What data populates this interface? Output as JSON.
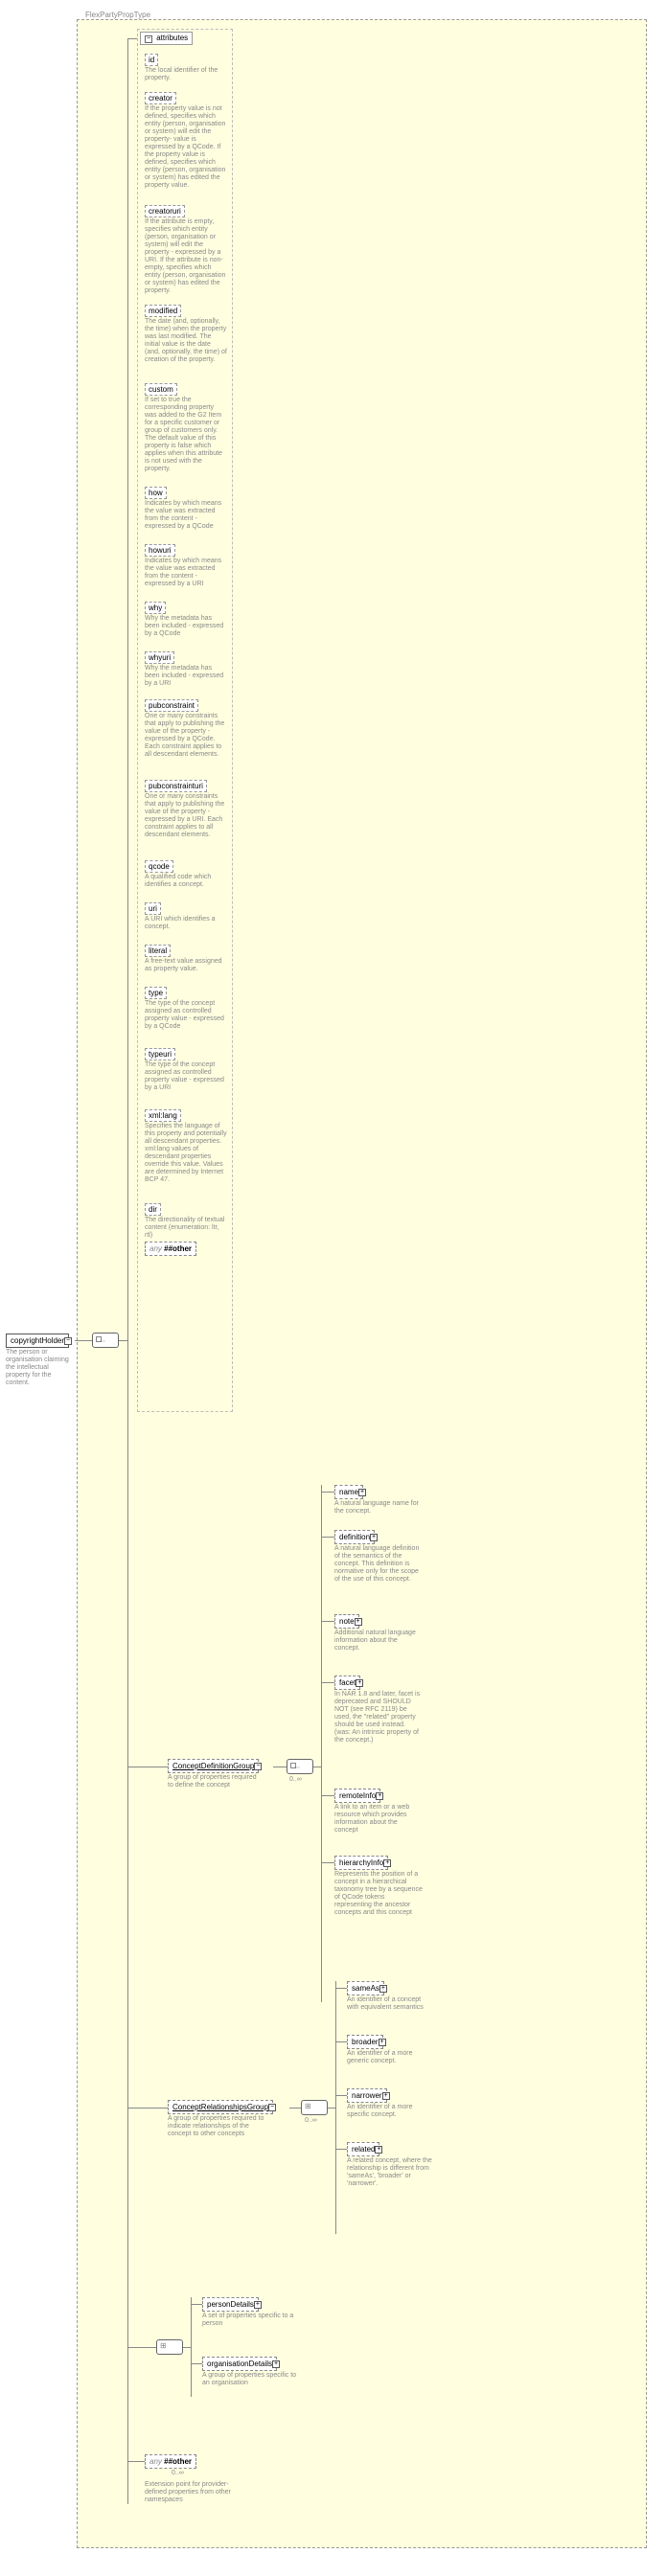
{
  "type": {
    "name": "FlexPartyPropType"
  },
  "root": {
    "name": "copyrightHolder",
    "doc": "The person or organisation claiming the intellectual property for the content."
  },
  "attributes": {
    "header": "attributes",
    "items": [
      {
        "name": "id",
        "doc": "The local identifier of the property."
      },
      {
        "name": "creator",
        "doc": "If the property value is not defined, specifies which entity (person, organisation or system) will edit the property- value is expressed by a QCode. If the property value is defined, specifies which entity (person, organisation or system) has edited the property value."
      },
      {
        "name": "creatoruri",
        "doc": "If the attribute is empty, specifies which entity (person, organisation or system) will edit the property - expressed by a URI. If the attribute is non-empty, specifies which entity (person, organisation or system) has edited the property."
      },
      {
        "name": "modified",
        "doc": "The date (and, optionally, the time) when the property was last modified. The initial value is the date (and, optionally, the time) of creation of the property."
      },
      {
        "name": "custom",
        "doc": "If set to true the corresponding property was added to the G2 Item for a specific customer or group of customers only. The default value of this property is false which applies when this attribute is not used with the property."
      },
      {
        "name": "how",
        "doc": "Indicates by which means the value was extracted from the content - expressed by a QCode"
      },
      {
        "name": "howuri",
        "doc": "Indicates by which means the value was extracted from the content - expressed by a URI"
      },
      {
        "name": "why",
        "doc": "Why the metadata has been included - expressed by a QCode"
      },
      {
        "name": "whyuri",
        "doc": "Why the metadata has been included - expressed by a URI"
      },
      {
        "name": "pubconstraint",
        "doc": "One or many constraints that apply to publishing the value of the property - expressed by a QCode. Each constraint applies to all descendant elements."
      },
      {
        "name": "pubconstrainturi",
        "doc": "One or many constraints that apply to publishing the value of the property - expressed by a URI. Each constraint applies to all descendant elements."
      },
      {
        "name": "qcode",
        "doc": "A qualified code which identifies a concept."
      },
      {
        "name": "uri",
        "doc": "A URI which identifies a concept."
      },
      {
        "name": "literal",
        "doc": "A free-text value assigned as property value."
      },
      {
        "name": "type",
        "doc": "The type of the concept assigned as controlled property value - expressed by a QCode"
      },
      {
        "name": "typeuri",
        "doc": "The type of the concept assigned as controlled property value - expressed by a URI"
      },
      {
        "name": "xml:lang",
        "doc": "Specifies the language of this property and potentially all descendant properties. xml:lang values of descendant properties override this value. Values are determined by Internet BCP 47."
      },
      {
        "name": "dir",
        "doc": "The directionality of textual content (enumeration: ltr, rtl)"
      }
    ],
    "any_label": "##other",
    "any_prefix": "any"
  },
  "groups": {
    "concept_def": {
      "name": "ConceptDefinitionGroup",
      "doc": "A group of properties required to define the concept",
      "occur": "0..∞",
      "children": [
        {
          "name": "name",
          "doc": "A natural language name for the concept."
        },
        {
          "name": "definition",
          "doc": "A natural language definition of the semantics of the concept. This definition is normative only for the scope of the use of this concept."
        },
        {
          "name": "note",
          "doc": "Additional natural language information about the concept."
        },
        {
          "name": "facet",
          "doc": "In NAR 1.8 and later, facet is deprecated and SHOULD NOT (see RFC 2119) be used, the \"related\" property should be used instead. (was: An intrinsic property of the concept.)"
        },
        {
          "name": "remoteInfo",
          "doc": "A link to an item or a web resource which provides information about the concept"
        },
        {
          "name": "hierarchyInfo",
          "doc": "Represents the position of a concept in a hierarchical taxonomy tree by a sequence of QCode tokens representing the ancestor concepts and this concept"
        }
      ]
    },
    "concept_rel": {
      "name": "ConceptRelationshipsGroup",
      "doc": "A group of properties required to indicate relationships of the concept to other concepts",
      "occur": "0..∞",
      "children": [
        {
          "name": "sameAs",
          "doc": "An identifier of a concept with equivalent semantics"
        },
        {
          "name": "broader",
          "doc": "An identifier of a more generic concept."
        },
        {
          "name": "narrower",
          "doc": "An identifier of a more specific concept."
        },
        {
          "name": "related",
          "doc": "A related concept, where the relationship is different from 'sameAs', 'broader' or 'narrower'."
        }
      ]
    },
    "choice": {
      "children": [
        {
          "name": "personDetails",
          "doc": "A set of properties specific to a person"
        },
        {
          "name": "organisationDetails",
          "doc": "A group of properties specific to an organisation"
        }
      ]
    },
    "any_bottom": {
      "prefix": "any",
      "label": "##other",
      "occur": "0..∞",
      "doc": "Extension point for provider-defined properties from other namespaces"
    }
  }
}
